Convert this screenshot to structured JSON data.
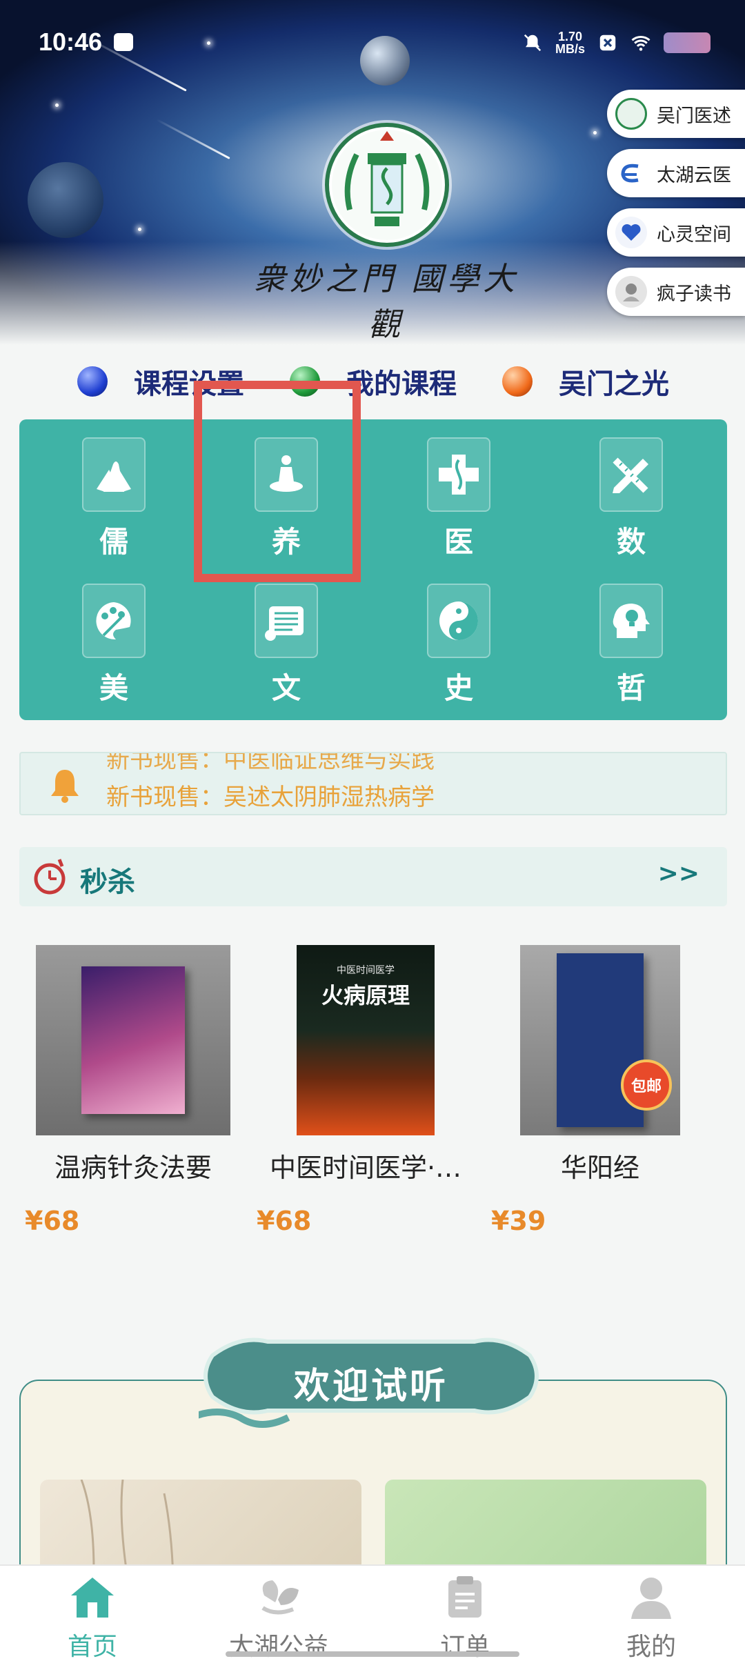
{
  "status": {
    "time": "10:46",
    "net_speed_value": "1.70",
    "net_speed_unit": "MB/s"
  },
  "hero": {
    "title": "衆妙之門 國學大觀"
  },
  "side_links": [
    {
      "label": "吴门医述",
      "icon": "wumen-logo-icon"
    },
    {
      "label": "太湖云医",
      "icon": "taihu-cloud-logo-icon"
    },
    {
      "label": "心灵空间",
      "icon": "heart-space-logo-icon"
    },
    {
      "label": "疯子读书",
      "icon": "reading-logo-icon"
    }
  ],
  "header_tabs": [
    {
      "label": "课程设置",
      "color": "#1f3fd1"
    },
    {
      "label": "我的课程",
      "color": "#1f9a3a"
    },
    {
      "label": "吴门之光",
      "color": "#f06a1a"
    }
  ],
  "categories": [
    {
      "label": "儒",
      "icon": "praying-hands-icon"
    },
    {
      "label": "养",
      "icon": "meditation-icon"
    },
    {
      "label": "医",
      "icon": "medical-cross-icon"
    },
    {
      "label": "数",
      "icon": "pencil-ruler-icon"
    },
    {
      "label": "美",
      "icon": "palette-icon"
    },
    {
      "label": "文",
      "icon": "scroll-icon"
    },
    {
      "label": "史",
      "icon": "yin-yang-icon"
    },
    {
      "label": "哲",
      "icon": "head-bulb-icon"
    }
  ],
  "notice": {
    "text": "新书现售：吴述太阴肺湿热病学",
    "ghost_text": "新书现售：中医临证思维与实践"
  },
  "flash_sale": {
    "title": "秒杀",
    "more": ">>"
  },
  "books": [
    {
      "name": "温病针灸法要",
      "price": "¥68"
    },
    {
      "name": "中医时间医学·…",
      "price": "¥68",
      "cover_title": "火病原理",
      "cover_sub": "中医时间医学"
    },
    {
      "name": "华阳经",
      "price": "¥39",
      "badge": "包邮"
    }
  ],
  "welcome": {
    "title": "欢迎试听"
  },
  "bottom_nav": [
    {
      "label": "首页",
      "icon": "home-icon",
      "active": true
    },
    {
      "label": "太湖公益",
      "icon": "charity-icon",
      "active": false
    },
    {
      "label": "订单",
      "icon": "clipboard-icon",
      "active": false
    },
    {
      "label": "我的",
      "icon": "user-icon",
      "active": false
    }
  ],
  "colors": {
    "teal": "#3fb3a6",
    "price": "#e88a2a",
    "highlight": "#e2574f"
  }
}
